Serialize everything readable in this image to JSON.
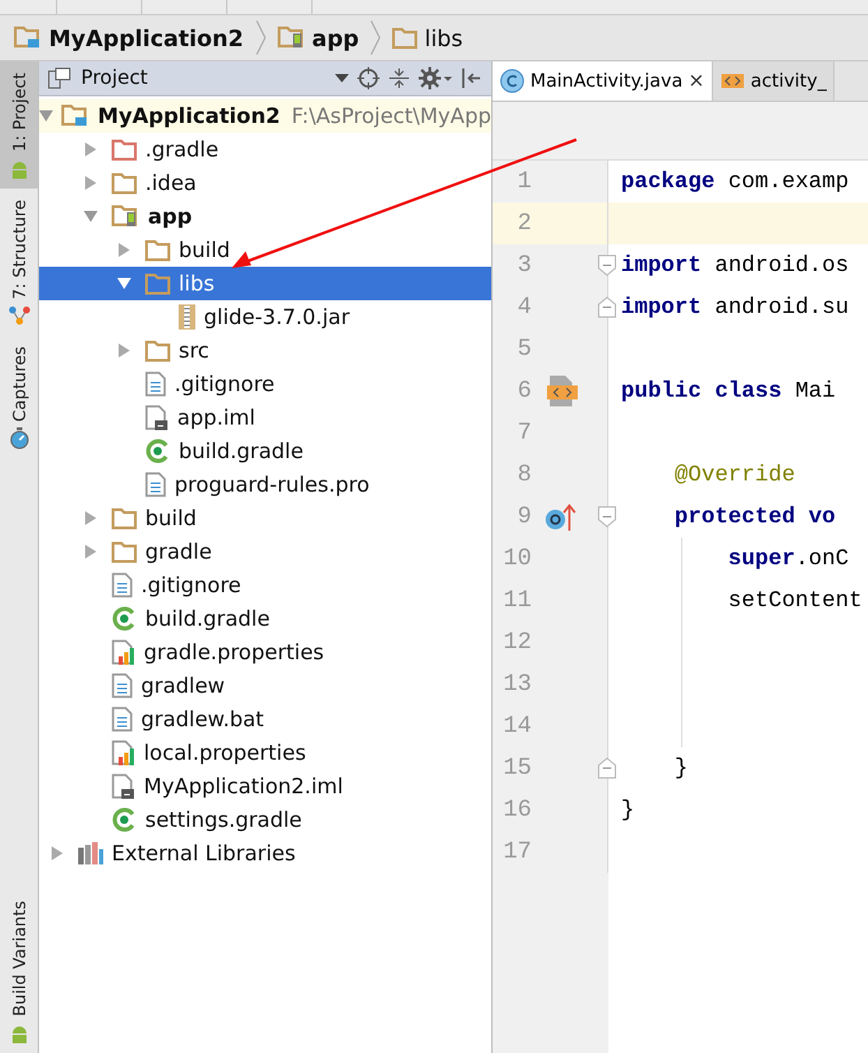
{
  "breadcrumb": [
    {
      "label": "MyApplication2",
      "kind": "project"
    },
    {
      "label": "app",
      "kind": "module"
    },
    {
      "label": "libs",
      "kind": "folder"
    }
  ],
  "tool_strip": {
    "top": [
      {
        "label": "1: Project",
        "kind": "android",
        "selected": true
      },
      {
        "label": "7: Structure",
        "kind": "structure",
        "selected": false
      },
      {
        "label": "Captures",
        "kind": "captures",
        "selected": false
      }
    ],
    "bottom": [
      {
        "label": "Build Variants",
        "kind": "android",
        "selected": false
      }
    ]
  },
  "project_panel": {
    "title": "Project",
    "tree": [
      {
        "label": "MyApplication2",
        "path": "F:\\AsProject\\MyApp",
        "kind": "project",
        "expanded": true,
        "selected": false,
        "children": [
          {
            "label": ".gradle",
            "kind": "excluded",
            "expanded": false,
            "selected": false
          },
          {
            "label": ".idea",
            "kind": "folder",
            "expanded": false,
            "selected": false
          },
          {
            "label": "app",
            "kind": "module",
            "expanded": true,
            "selected": false,
            "children": [
              {
                "label": "build",
                "kind": "folder",
                "expanded": false,
                "selected": false
              },
              {
                "label": "libs",
                "kind": "folder",
                "expanded": true,
                "selected": true,
                "children": [
                  {
                    "label": "glide-3.7.0.jar",
                    "kind": "jar",
                    "selected": false
                  }
                ]
              },
              {
                "label": "src",
                "kind": "folder",
                "expanded": false,
                "selected": false
              },
              {
                "label": ".gitignore",
                "kind": "text",
                "selected": false
              },
              {
                "label": "app.iml",
                "kind": "iml",
                "selected": false
              },
              {
                "label": "build.gradle",
                "kind": "gradle",
                "selected": false
              },
              {
                "label": "proguard-rules.pro",
                "kind": "text",
                "selected": false
              }
            ]
          },
          {
            "label": "build",
            "kind": "folder",
            "expanded": false,
            "selected": false
          },
          {
            "label": "gradle",
            "kind": "folder",
            "expanded": false,
            "selected": false
          },
          {
            "label": ".gitignore",
            "kind": "text",
            "selected": false
          },
          {
            "label": "build.gradle",
            "kind": "gradle",
            "selected": false
          },
          {
            "label": "gradle.properties",
            "kind": "properties",
            "selected": false
          },
          {
            "label": "gradlew",
            "kind": "text",
            "selected": false
          },
          {
            "label": "gradlew.bat",
            "kind": "text",
            "selected": false
          },
          {
            "label": "local.properties",
            "kind": "properties",
            "selected": false
          },
          {
            "label": "MyApplication2.iml",
            "kind": "iml",
            "selected": false
          },
          {
            "label": "settings.gradle",
            "kind": "gradle",
            "selected": false
          }
        ]
      },
      {
        "label": "External Libraries",
        "kind": "libraries",
        "expanded": false,
        "selected": false
      }
    ]
  },
  "editor": {
    "tabs": [
      {
        "label": "MainActivity.java",
        "kind": "class",
        "selected": true,
        "close": "×"
      },
      {
        "label": "activity_",
        "kind": "layout",
        "selected": false
      }
    ],
    "lines": [
      {
        "number": "1",
        "current": false,
        "kind": "top",
        "segments": [
          {
            "kind": "keyword",
            "text": "package"
          },
          {
            "kind": "plain",
            "text": " com.examp"
          }
        ]
      },
      {
        "number": "2",
        "current": true
      },
      {
        "number": "3",
        "current": false,
        "kind": "top",
        "fold": {
          "kind": "start"
        },
        "segments": [
          {
            "kind": "keyword",
            "text": "import"
          },
          {
            "kind": "plain",
            "text": " android.os"
          }
        ]
      },
      {
        "number": "4",
        "current": false,
        "kind": "top",
        "fold": {
          "kind": "end"
        },
        "segments": [
          {
            "kind": "keyword",
            "text": "import"
          },
          {
            "kind": "plain",
            "text": " android.su"
          }
        ]
      },
      {
        "number": "5",
        "current": false
      },
      {
        "number": "6",
        "current": false,
        "kind": "top",
        "gutter_icon": {
          "kind": "layout"
        },
        "segments": [
          {
            "kind": "keyword",
            "text": "public class"
          },
          {
            "kind": "plain",
            "text": " Mai"
          }
        ]
      },
      {
        "number": "7",
        "current": false
      },
      {
        "number": "8",
        "current": false,
        "kind": "member",
        "segments": [
          {
            "kind": "annotation",
            "text": "@Override"
          }
        ]
      },
      {
        "number": "9",
        "current": false,
        "kind": "member",
        "gutter_icon": {
          "kind": "override"
        },
        "fold": {
          "kind": "start"
        },
        "segments": [
          {
            "kind": "keyword",
            "text": "protected vo"
          }
        ]
      },
      {
        "number": "10",
        "current": false,
        "kind": "body",
        "segments": [
          {
            "kind": "keyword",
            "text": "super"
          },
          {
            "kind": "plain",
            "text": ".onC"
          }
        ]
      },
      {
        "number": "11",
        "current": false,
        "kind": "body",
        "segments": [
          {
            "kind": "plain",
            "text": "setContent"
          }
        ]
      },
      {
        "number": "12",
        "current": false,
        "kind": "body"
      },
      {
        "number": "13",
        "current": false,
        "kind": "body"
      },
      {
        "number": "14",
        "current": false,
        "kind": "body"
      },
      {
        "number": "15",
        "current": false,
        "kind": "member",
        "fold": {
          "kind": "end"
        },
        "segments": [
          {
            "kind": "brace",
            "text": "}"
          }
        ]
      },
      {
        "number": "16",
        "current": false,
        "kind": "top",
        "segments": [
          {
            "kind": "brace",
            "text": "}"
          }
        ]
      },
      {
        "number": "17",
        "current": false
      }
    ]
  }
}
